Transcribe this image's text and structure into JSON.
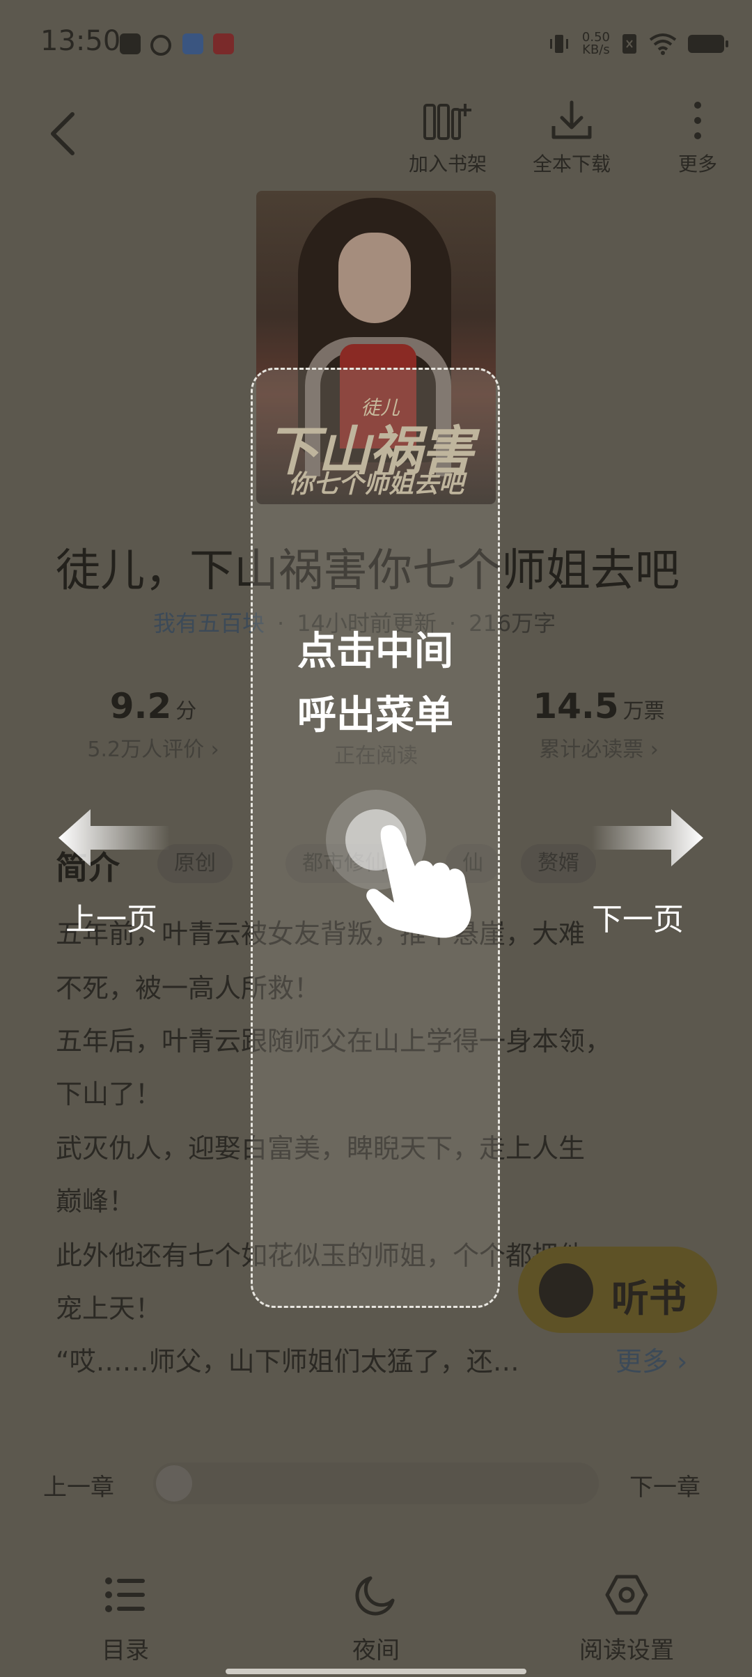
{
  "status_bar": {
    "time": "13:50",
    "net_speed_value": "0.50",
    "net_speed_unit": "KB/s"
  },
  "top_bar": {
    "add_shelf": "加入书架",
    "download_all": "全本下载",
    "more": "更多"
  },
  "book": {
    "title": "徒儿，下山祸害你七个师姐去吧",
    "author": "我有五百块",
    "updated": "14小时前更新",
    "words": "216万字",
    "cover_text_small": "徒儿",
    "cover_text_big": "下山祸害",
    "cover_text_sub": "你七个师姐去吧"
  },
  "stats": {
    "score": "9.2",
    "score_unit": "分",
    "score_sub": "5.2万人评价 ›",
    "reading_sub": "正在阅读",
    "votes": "14.5",
    "votes_unit": "万票",
    "votes_sub": "累计必读票 ›"
  },
  "intro": {
    "heading": "简介",
    "tags": [
      "原创",
      "都市修仙",
      "仙",
      "赘婿"
    ],
    "lines": [
      "五年前，叶青云被女友背叛，推下悬崖，大难",
      "不死，被一高人所救！",
      "五年后，叶青云跟随师父在山上学得一身本领，",
      "下山了！",
      "武灭仇人，迎娶白富美，睥睨天下，走上人生",
      "巅峰！",
      "此外他还有七个如花似玉的师姐，个个都把他",
      "宠上天！",
      "“哎……师父，山下师姐们太猛了，还…"
    ],
    "more": "更多 ›"
  },
  "listen_button": "听书",
  "chapter_nav": {
    "prev": "上一章",
    "next": "下一章"
  },
  "bottom_nav": {
    "toc": "目录",
    "night": "夜间",
    "settings": "阅读设置"
  },
  "guide": {
    "center_line1": "点击中间",
    "center_line2": "呼出菜单",
    "prev_page": "上一页",
    "next_page": "下一页"
  }
}
